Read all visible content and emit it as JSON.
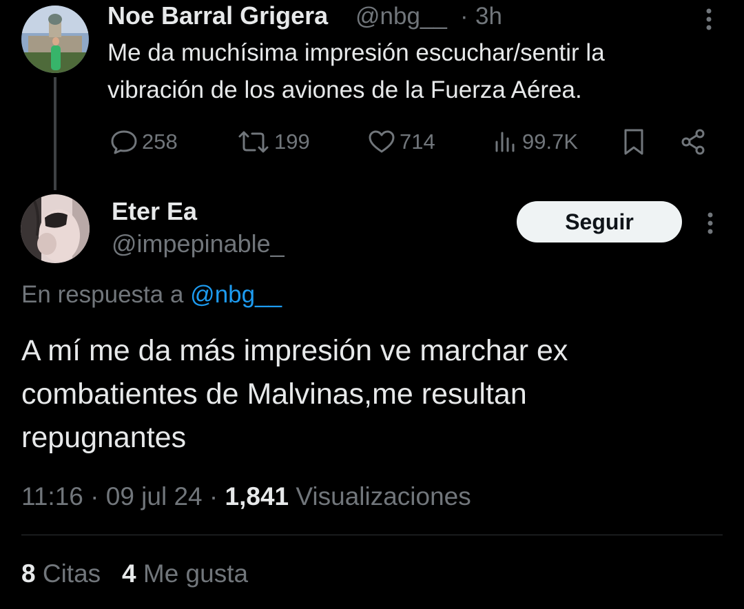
{
  "parent_tweet": {
    "author_name": "Noe Barral Grigera",
    "author_handle": "@nbg__",
    "separator": "·",
    "time_ago": "3h",
    "text_line1": "Me da muchísima impresión escuchar/sentir la",
    "text_line2": "vibración de los aviones de la Fuerza Aérea.",
    "actions": {
      "reply_icon": "comment-icon",
      "replies": "258",
      "retweet_icon": "retweet-icon",
      "retweets": "199",
      "like_icon": "heart-icon",
      "likes": "714",
      "views_icon": "bar-chart-icon",
      "views": "99.7K",
      "bookmark_icon": "bookmark-icon",
      "share_icon": "share-icon"
    },
    "more_icon": "vertical-ellipsis-icon"
  },
  "reply_tweet": {
    "author_name": "Eter Ea",
    "author_handle": "@impepinable_",
    "follow_label": "Seguir",
    "more_icon": "vertical-ellipsis-icon",
    "in_reply_prefix": "En respuesta a",
    "in_reply_mention": "@nbg__",
    "text_line1": "A mí me da más impresión ve marchar ex",
    "text_line2": "combatientes de Malvinas,me resultan",
    "text_line3": "repugnantes",
    "time": "11:16",
    "date": "09 jul 24",
    "separator": "·",
    "views_count": "1,841",
    "views_label": "Visualizaciones",
    "quotes_count": "8",
    "quotes_label": "Citas",
    "likes_count": "4",
    "likes_label": "Me gusta"
  },
  "colors": {
    "background": "#000000",
    "text_primary": "#e7e9ea",
    "text_secondary": "#71767b",
    "link": "#1d9bf0",
    "button_bg": "#eff3f4"
  }
}
